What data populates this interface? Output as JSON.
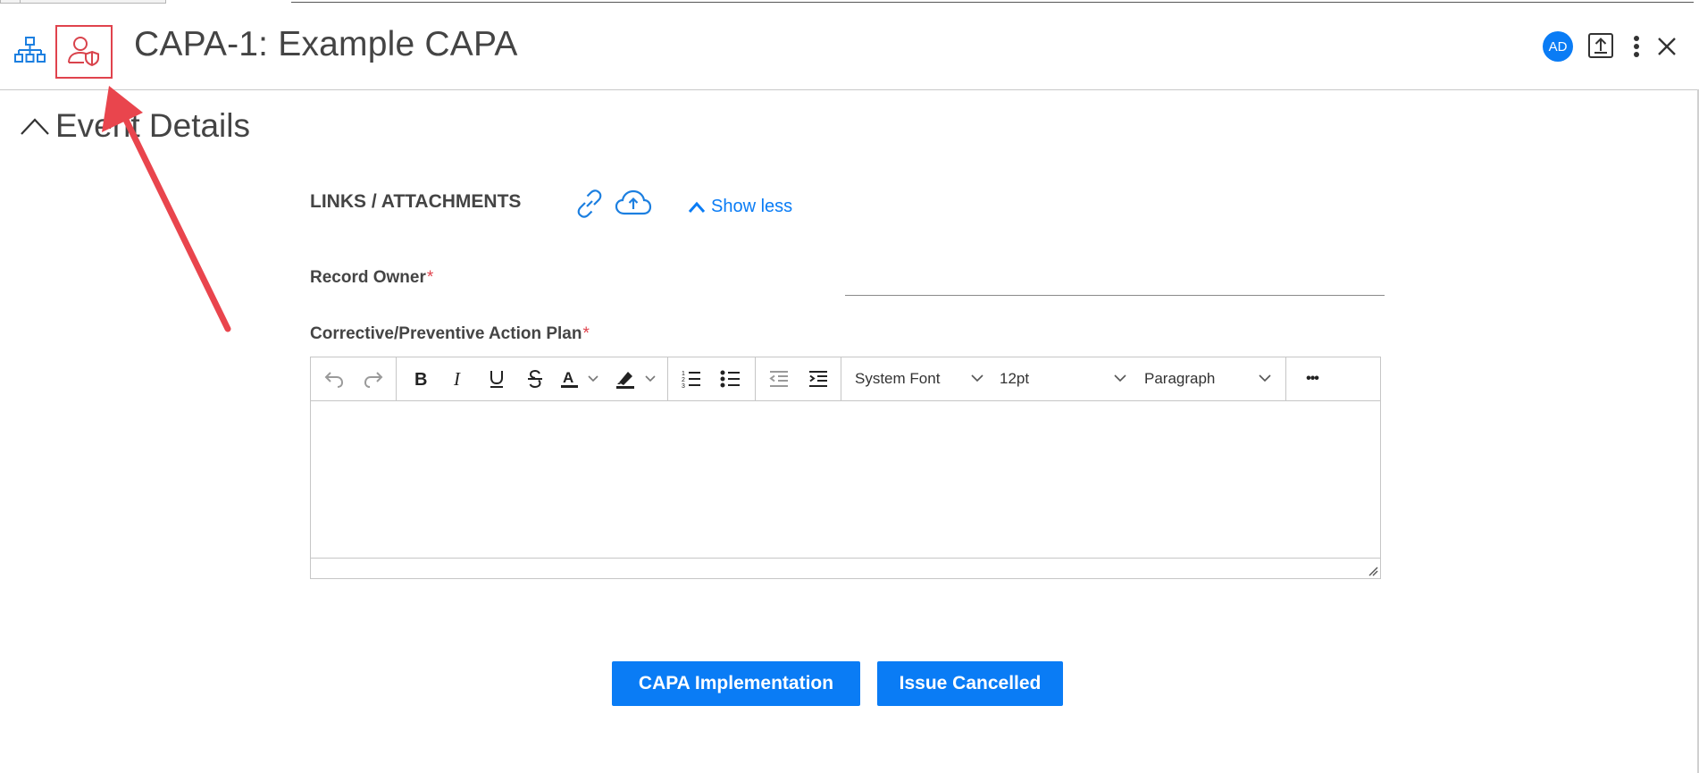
{
  "header": {
    "title": "CAPA-1: Example CAPA",
    "avatar_initials": "AD",
    "icons": [
      "hierarchy-icon",
      "record-owner-security-icon",
      "export-icon",
      "more-vertical-icon",
      "close-icon"
    ]
  },
  "section": {
    "title": "Event Details",
    "collapse_icon": "chevron-up-icon"
  },
  "links": {
    "label": "LINKS / ATTACHMENTS",
    "show_less": "Show less",
    "icons": [
      "link-icon",
      "cloud-upload-icon"
    ]
  },
  "fields": {
    "record_owner": {
      "label": "Record Owner",
      "required_mark": "*",
      "value": ""
    },
    "action_plan": {
      "label": "Corrective/Preventive Action Plan",
      "required_mark": "*",
      "value": ""
    }
  },
  "editor": {
    "font_family": "System Font",
    "font_size": "12pt",
    "block_format": "Paragraph",
    "more": "•••"
  },
  "buttons": {
    "implementation": "CAPA Implementation",
    "cancelled": "Issue Cancelled"
  },
  "colors": {
    "accent": "#0a7cf5",
    "annotation": "#e0434d",
    "required": "#e0434d"
  }
}
